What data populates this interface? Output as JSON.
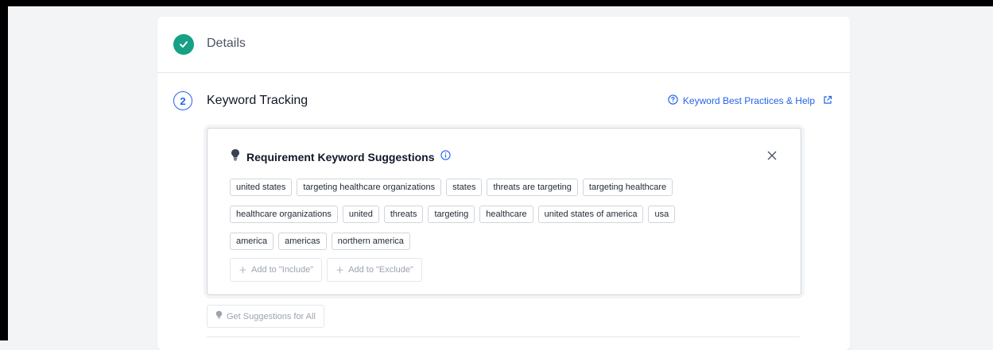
{
  "steps": {
    "step1": {
      "title": "Details",
      "status": "complete"
    },
    "step2": {
      "number": "2",
      "title": "Keyword Tracking"
    }
  },
  "help": {
    "label": "Keyword Best Practices & Help"
  },
  "suggestions": {
    "title": "Requirement Keyword Suggestions",
    "chips": [
      "united states",
      "targeting healthcare organizations",
      "states",
      "threats are targeting",
      "targeting healthcare",
      "healthcare organizations",
      "united",
      "threats",
      "targeting",
      "healthcare",
      "united states of america",
      "usa",
      "america",
      "americas",
      "northern america"
    ],
    "add_include": "Add to \"Include\"",
    "add_exclude": "Add to \"Exclude\""
  },
  "get_all_label": "Get Suggestions for All",
  "colors": {
    "accent": "#2563eb",
    "success": "#16a085"
  }
}
